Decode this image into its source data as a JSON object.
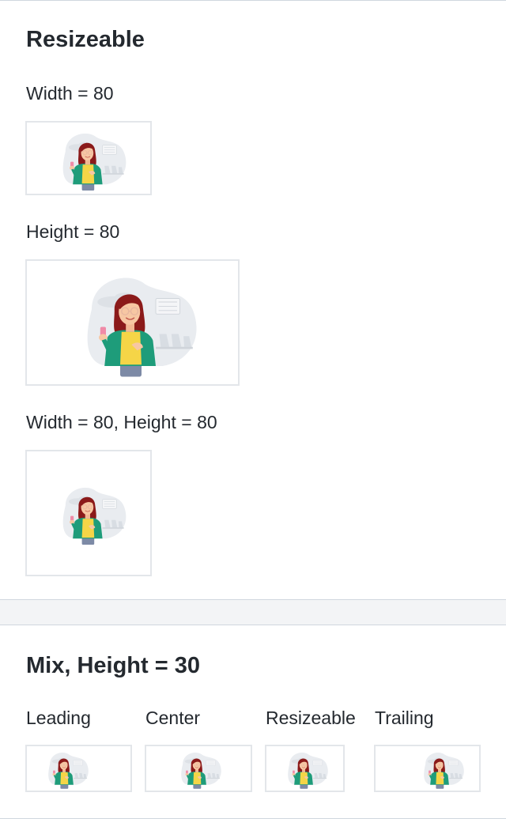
{
  "resizeable": {
    "title": "Resizeable",
    "examples": [
      {
        "label": "Width = 80"
      },
      {
        "label": "Height = 80"
      },
      {
        "label": "Width = 80, Height = 80"
      }
    ]
  },
  "mix": {
    "title": "Mix, Height = 30",
    "columns": [
      {
        "label": "Leading"
      },
      {
        "label": "Center"
      },
      {
        "label": "Resizeable"
      },
      {
        "label": "Trailing"
      }
    ]
  },
  "illustration": {
    "name": "woman-with-phone-illustration",
    "colors": {
      "blob": "#e9ecf0",
      "chairs": "#d8dde3",
      "hair": "#8b1a1a",
      "skin": "#f7c7a3",
      "jacket": "#1e9c7a",
      "shirt": "#f5d547",
      "pants": "#7d8aa6",
      "phone": "#f08aa7",
      "glasses": "#e8b7a0"
    }
  }
}
